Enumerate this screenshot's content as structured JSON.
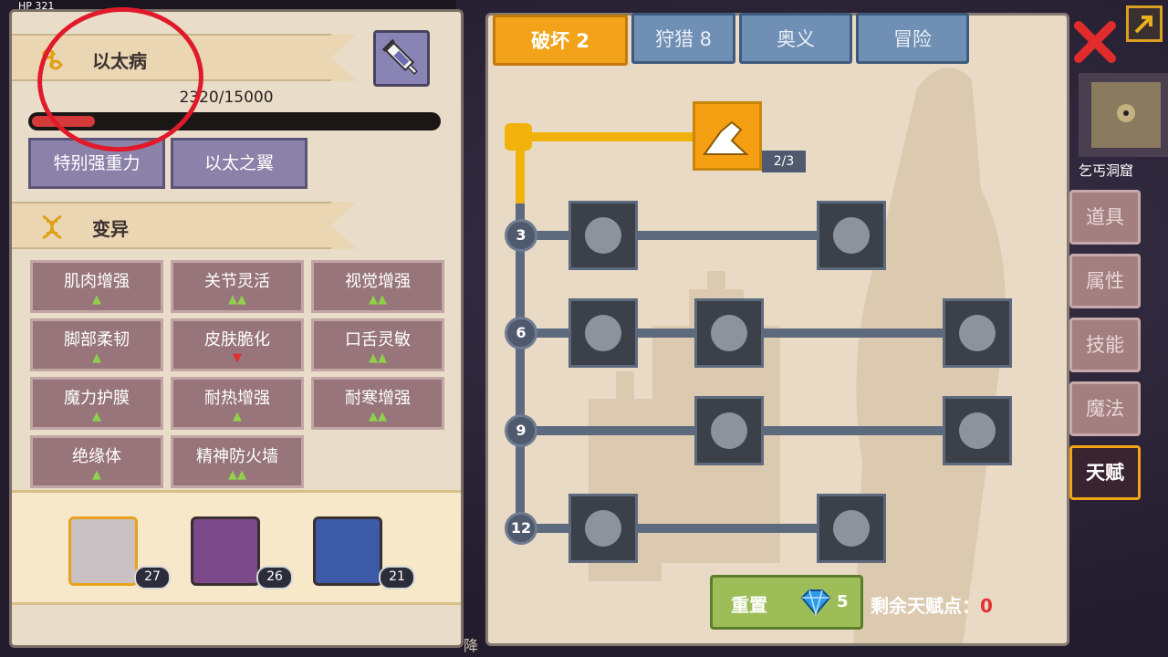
{
  "header": {
    "hud_text": "HP 321"
  },
  "left": {
    "disease_title": "以太病",
    "progress_text": "2320/15000",
    "progress": {
      "current": 2320,
      "max": 15000
    },
    "buttons": [
      "特别强重力",
      "以太之翼"
    ],
    "mutation_title": "变异",
    "mutations": [
      {
        "name": "肌肉增强",
        "arrows": "▲",
        "dir": "up"
      },
      {
        "name": "关节灵活",
        "arrows": "▲▲",
        "dir": "up"
      },
      {
        "name": "视觉增强",
        "arrows": "▲▲",
        "dir": "up"
      },
      {
        "name": "脚部柔韧",
        "arrows": "▲",
        "dir": "up"
      },
      {
        "name": "皮肤脆化",
        "arrows": "▼",
        "dir": "down"
      },
      {
        "name": "口舌灵敏",
        "arrows": "▲▲",
        "dir": "up"
      },
      {
        "name": "魔力护膜",
        "arrows": "▲",
        "dir": "up"
      },
      {
        "name": "耐热增强",
        "arrows": "▲",
        "dir": "up"
      },
      {
        "name": "耐寒增强",
        "arrows": "▲▲",
        "dir": "up"
      },
      {
        "name": "绝缘体",
        "arrows": "▲",
        "dir": "up"
      },
      {
        "name": "精神防火墙",
        "arrows": "▲▲",
        "dir": "up"
      }
    ],
    "team": [
      {
        "level": "27",
        "selected": true,
        "color": "#c9c1c4"
      },
      {
        "level": "26",
        "selected": false,
        "color": "#7c4a8a"
      },
      {
        "level": "21",
        "selected": false,
        "color": "#3c5aa8"
      }
    ]
  },
  "tabs": [
    {
      "label": "破坏 2",
      "active": true
    },
    {
      "label": "狩猎 8",
      "active": false
    },
    {
      "label": "奥义",
      "active": false
    },
    {
      "label": "冒险",
      "active": false
    }
  ],
  "tree": {
    "root_progress": "2/3",
    "tiers": [
      "3",
      "6",
      "9",
      "12"
    ]
  },
  "side_tabs": [
    {
      "label": "道具",
      "active": false
    },
    {
      "label": "属性",
      "active": false
    },
    {
      "label": "技能",
      "active": false
    },
    {
      "label": "魔法",
      "active": false
    },
    {
      "label": "天赋",
      "active": true
    }
  ],
  "map_label": "乞丐洞窟",
  "bottom": {
    "reset_label": "重置",
    "gem_count": "5",
    "points_label": "剩余天赋点：",
    "points_value": "0",
    "partial_text": "降"
  },
  "colors": {
    "accent": "#f2a319",
    "tab_inactive": "#6f8fb4",
    "mutation_bg": "#97757b",
    "circle": "#e01a2a"
  }
}
